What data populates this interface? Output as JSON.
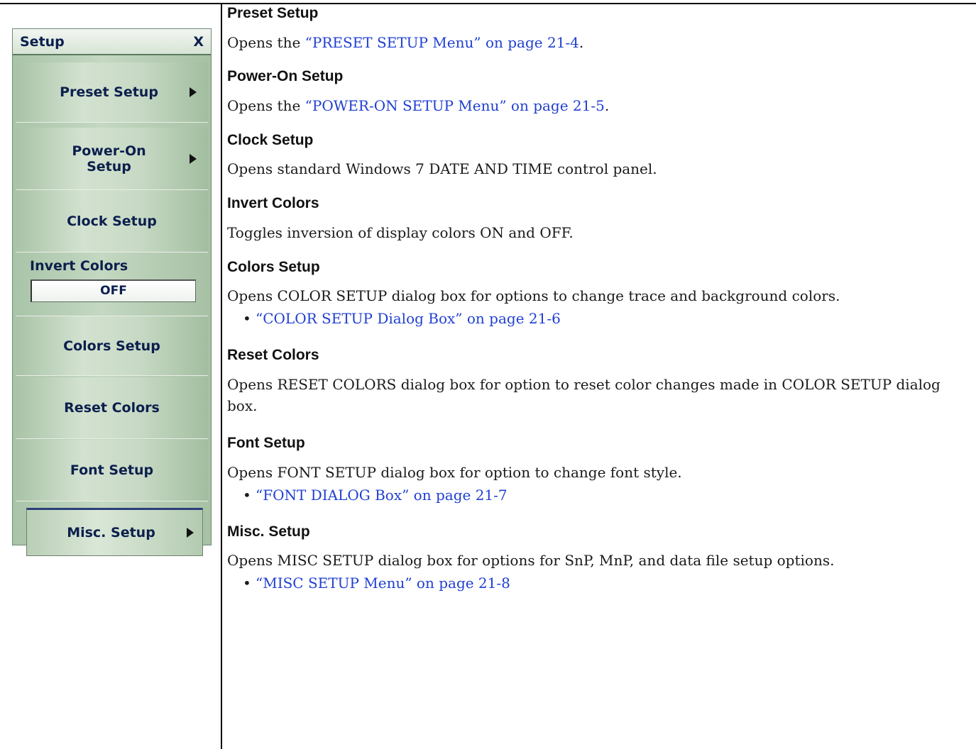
{
  "menu": {
    "title": "Setup",
    "close_label": "X",
    "items": [
      {
        "label": "Preset Setup"
      },
      {
        "label": "Power-On Setup"
      },
      {
        "label": "Clock Setup"
      },
      {
        "label": "Colors Setup"
      },
      {
        "label": "Reset Colors"
      },
      {
        "label": "Font Setup"
      }
    ],
    "invert": {
      "label": "Invert Colors",
      "value": "OFF"
    },
    "misc": {
      "label": "Misc. Setup"
    }
  },
  "doc": {
    "sections": [
      {
        "heading": "Preset Setup",
        "pre": "Opens the ",
        "link": "“PRESET SETUP Menu” on page 21-4",
        "post": "."
      },
      {
        "heading": "Power-On Setup",
        "pre": "Opens the ",
        "link": "“POWER-ON SETUP Menu” on page 21-5",
        "post": "."
      },
      {
        "heading": "Clock Setup",
        "text": "Opens standard Windows 7 DATE AND TIME control panel."
      },
      {
        "heading": "Invert Colors",
        "text": "Toggles inversion of display colors ON and OFF."
      },
      {
        "heading": "Colors Setup",
        "text": "Opens COLOR SETUP dialog box for options to change trace and background colors.",
        "bullet": "“COLOR SETUP Dialog Box” on page 21-6"
      },
      {
        "heading": "Reset Colors",
        "text": "Opens RESET COLORS dialog box for option to reset color changes made in COLOR SETUP dialog box."
      },
      {
        "heading": "Font Setup",
        "text": "Opens FONT SETUP dialog box for option to change font style.",
        "bullet": "“FONT DIALOG Box” on page 21-7"
      },
      {
        "heading": "Misc. Setup",
        "text": "Opens MISC SETUP dialog box for options for SnP, MnP, and data file setup options.",
        "bullet": "“MISC SETUP Menu” on page 21-8"
      }
    ]
  }
}
